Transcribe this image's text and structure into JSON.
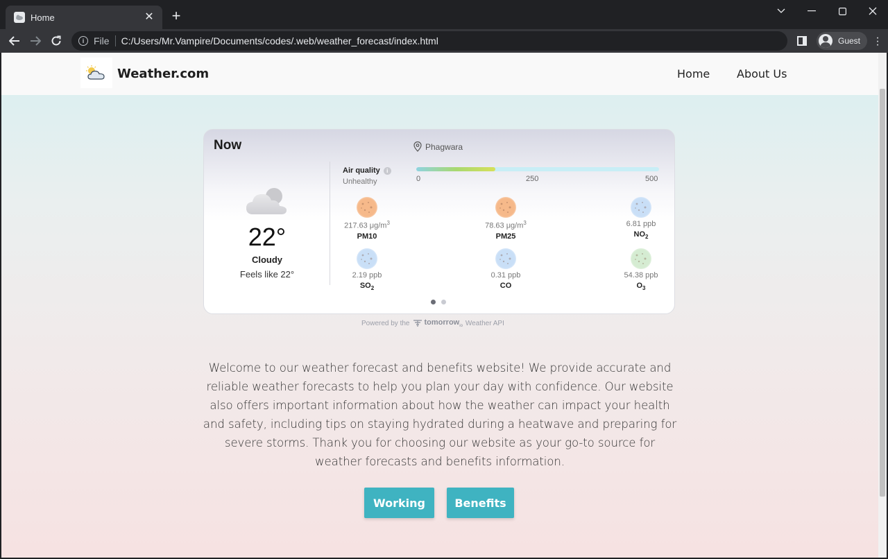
{
  "browser": {
    "tab_title": "Home",
    "url_scheme_label": "File",
    "url": "C:/Users/Mr.Vampire/Documents/codes/.web/weather_forecast/index.html",
    "profile_label": "Guest"
  },
  "site": {
    "brand": "Weather.com",
    "nav": [
      {
        "label": "Home"
      },
      {
        "label": "About Us"
      }
    ]
  },
  "widget": {
    "now_label": "Now",
    "location": "Phagwara",
    "temperature": "22°",
    "condition": "Cloudy",
    "feels_like": "Feels like 22°",
    "air_quality_label": "Air quality",
    "air_quality_status": "Unhealthy",
    "aqi_scale": [
      "0",
      "250",
      "500"
    ],
    "aqi_fill_fraction": 0.325,
    "pollutants": [
      {
        "value": "217.63 μg/m",
        "unit_sup": "3",
        "name": "PM10",
        "name_sub": "",
        "color": "#f6b98a"
      },
      {
        "value": "78.63 μg/m",
        "unit_sup": "3",
        "name": "PM25",
        "name_sub": "",
        "color": "#f6b98a"
      },
      {
        "value": "6.81 ppb",
        "unit_sup": "",
        "name": "NO",
        "name_sub": "2",
        "color": "#c9dff7"
      },
      {
        "value": "2.19 ppb",
        "unit_sup": "",
        "name": "SO",
        "name_sub": "2",
        "color": "#c9dff7"
      },
      {
        "value": "0.31 ppb",
        "unit_sup": "",
        "name": "CO",
        "name_sub": "",
        "color": "#c9dff7"
      },
      {
        "value": "54.38 ppb",
        "unit_sup": "",
        "name": "O",
        "name_sub": "3",
        "color": "#d5ecd2"
      }
    ],
    "powered_prefix": "Powered by the",
    "powered_brand": "tomorrow",
    "powered_brand_suffix": "io",
    "powered_suffix": "Weather API"
  },
  "welcome_text": "Welcome to our weather forecast and benefits website! We provide accurate and reliable weather forecasts to help you plan your day with confidence. Our website also offers important information about how the weather can impact your health and safety, including tips on staying hydrated during a heatwave and preparing for severe storms. Thank you for choosing our website as your go-to source for weather forecasts and benefits information.",
  "buttons": {
    "working": "Working",
    "benefits": "Benefits"
  },
  "colors": {
    "button_bg": "#3fb3c1",
    "aqi_track": "#c8eef6"
  }
}
